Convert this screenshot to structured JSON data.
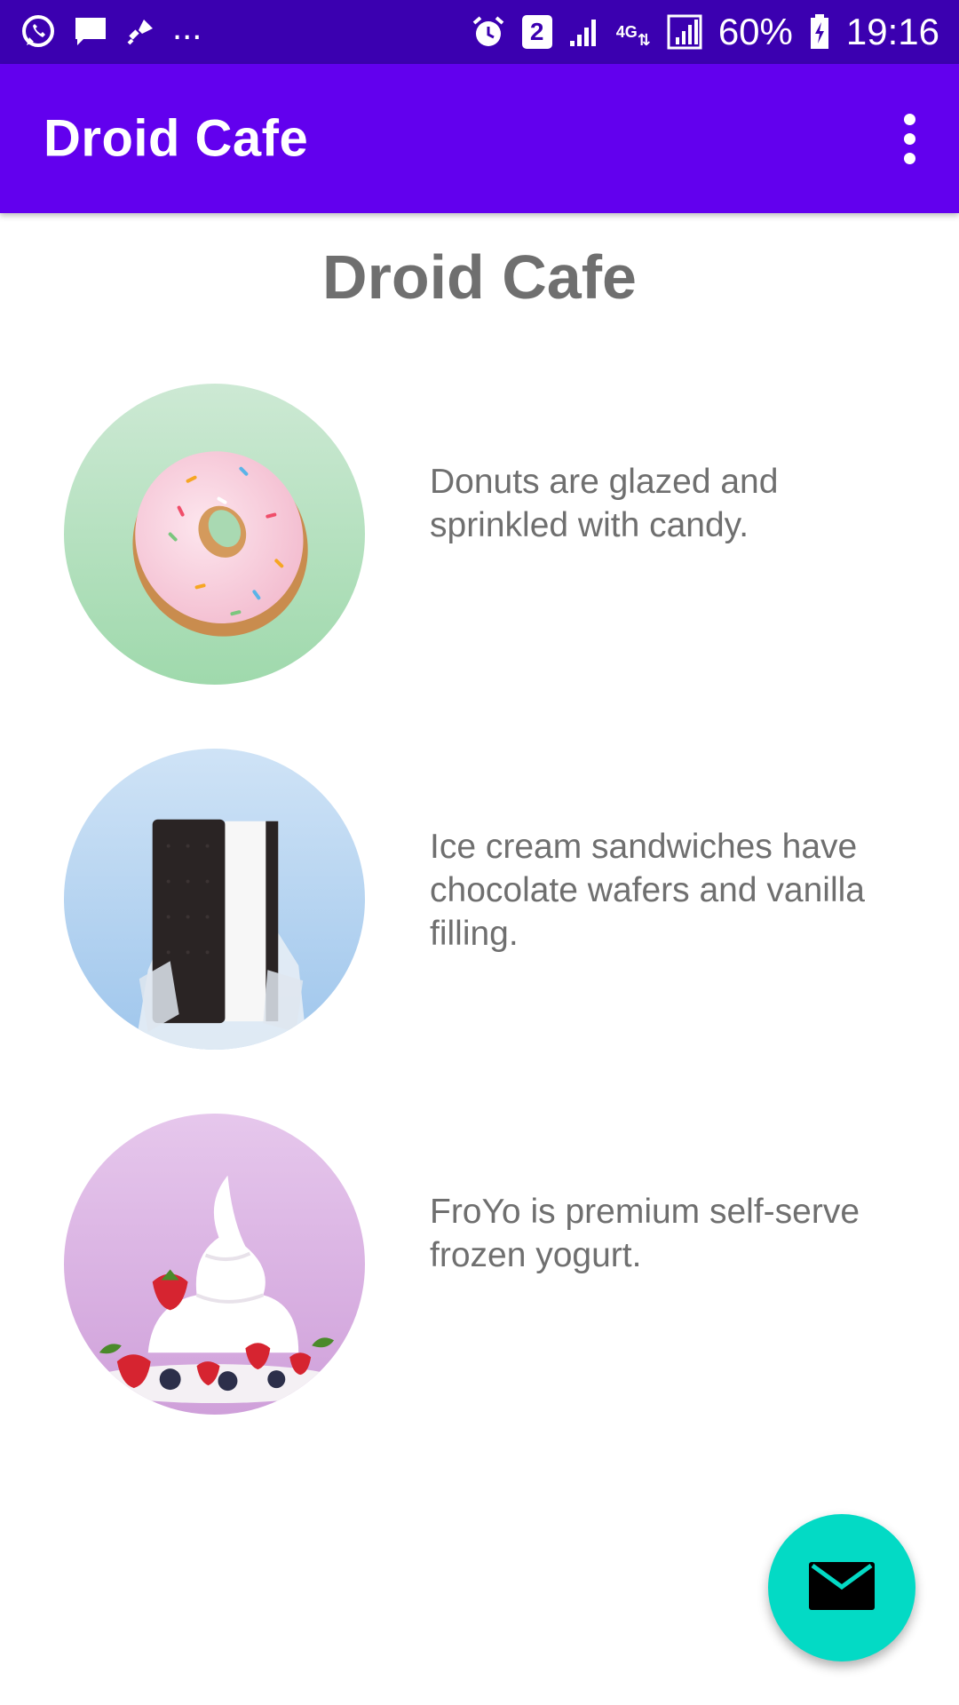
{
  "status_bar": {
    "sim_slot": "2",
    "network": "4G",
    "battery": "60%",
    "time": "19:16",
    "more_notifications": "...",
    "icons": [
      "whatsapp-icon",
      "message-icon",
      "vacuum-icon",
      "alarm-icon",
      "signal-icon",
      "battery-icon"
    ]
  },
  "app_bar": {
    "title": "Droid Cafe",
    "overflow_icon": "more-vert-icon",
    "color": "#6200EE"
  },
  "content": {
    "heading": "Droid Cafe",
    "items": [
      {
        "image": "donut",
        "description": "Donuts are glazed and sprinkled with candy."
      },
      {
        "image": "ice-cream-sandwich",
        "description": "Ice cream sandwiches have chocolate wafers and vanilla filling."
      },
      {
        "image": "froyo",
        "description": "FroYo is premium self-serve frozen yogurt."
      }
    ]
  },
  "fab": {
    "icon": "mail-icon",
    "color": "#03DAC5"
  }
}
